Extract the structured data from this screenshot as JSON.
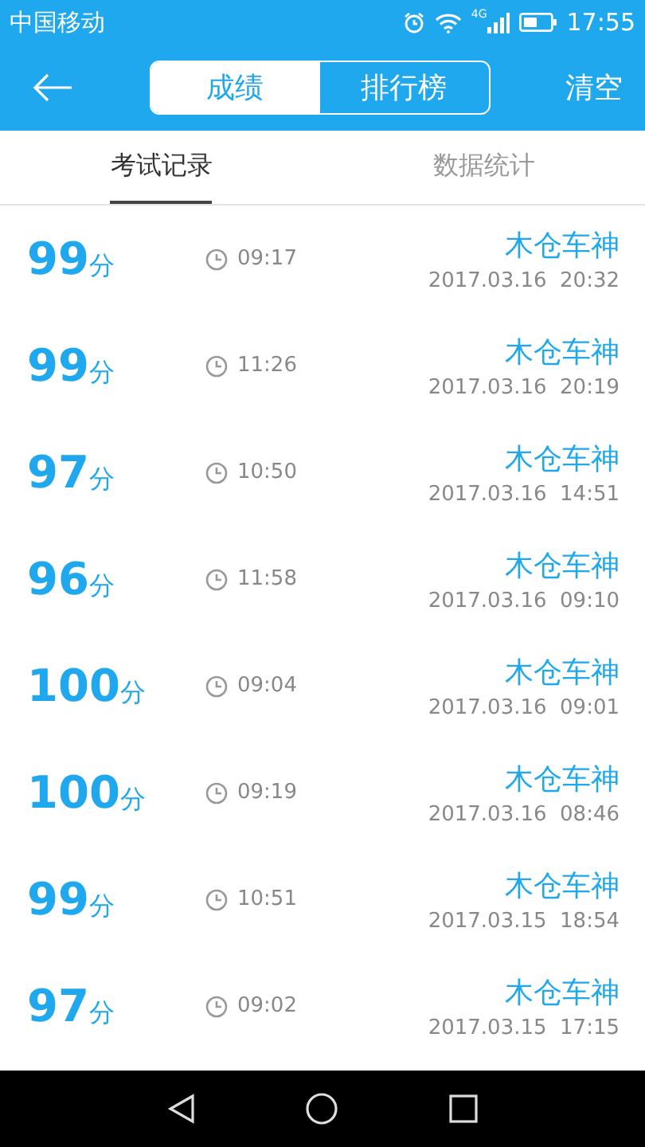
{
  "status_bar": {
    "carrier": "中国移动",
    "network": "4G",
    "time": "17:55"
  },
  "header": {
    "segments": [
      {
        "label": "成绩",
        "selected": true
      },
      {
        "label": "排行榜",
        "selected": false
      }
    ],
    "action": "清空"
  },
  "tabs": [
    {
      "label": "考试记录",
      "selected": true
    },
    {
      "label": "数据统计",
      "selected": false
    }
  ],
  "records": [
    {
      "score": "99",
      "unit": "分",
      "duration": "09:17",
      "name": "木仓车神",
      "date": "2017.03.16  20:32"
    },
    {
      "score": "99",
      "unit": "分",
      "duration": "11:26",
      "name": "木仓车神",
      "date": "2017.03.16  20:19"
    },
    {
      "score": "97",
      "unit": "分",
      "duration": "10:50",
      "name": "木仓车神",
      "date": "2017.03.16  14:51"
    },
    {
      "score": "96",
      "unit": "分",
      "duration": "11:58",
      "name": "木仓车神",
      "date": "2017.03.16  09:10"
    },
    {
      "score": "100",
      "unit": "分",
      "duration": "09:04",
      "name": "木仓车神",
      "date": "2017.03.16  09:01"
    },
    {
      "score": "100",
      "unit": "分",
      "duration": "09:19",
      "name": "木仓车神",
      "date": "2017.03.16  08:46"
    },
    {
      "score": "99",
      "unit": "分",
      "duration": "10:51",
      "name": "木仓车神",
      "date": "2017.03.15  18:54"
    },
    {
      "score": "97",
      "unit": "分",
      "duration": "09:02",
      "name": "木仓车神",
      "date": "2017.03.15  17:15"
    }
  ]
}
